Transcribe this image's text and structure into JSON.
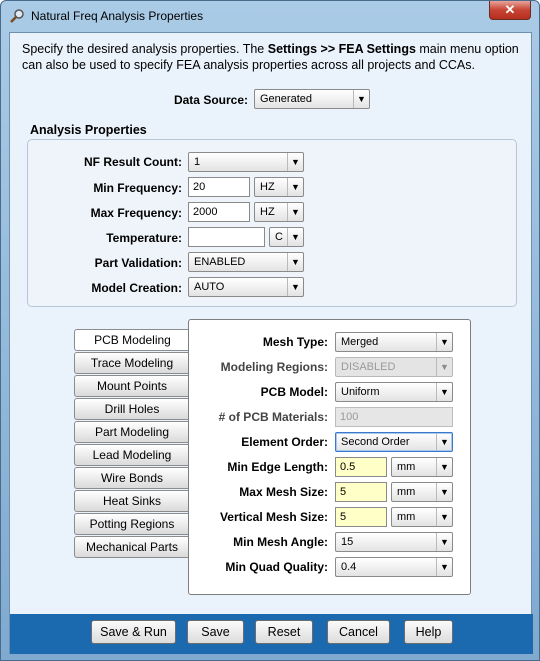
{
  "window": {
    "title": "Natural Freq Analysis Properties",
    "close_glyph": "✕"
  },
  "intro": {
    "part1": "Specify the desired analysis properties. The ",
    "bold": "Settings >> FEA Settings",
    "part2": " main menu option can also be used to specify FEA analysis properties across all projects and CCAs."
  },
  "data_source": {
    "label": "Data Source:",
    "value": "Generated"
  },
  "analysis_properties": {
    "title": "Analysis Properties",
    "nf_result_count": {
      "label": "NF Result Count:",
      "value": "1"
    },
    "min_frequency": {
      "label": "Min Frequency:",
      "value": "20",
      "unit": "HZ"
    },
    "max_frequency": {
      "label": "Max Frequency:",
      "value": "2000",
      "unit": "HZ"
    },
    "temperature": {
      "label": "Temperature:",
      "value": "",
      "unit": "C"
    },
    "part_validation": {
      "label": "Part Validation:",
      "value": "ENABLED"
    },
    "model_creation": {
      "label": "Model Creation:",
      "value": "AUTO"
    }
  },
  "tabs": [
    {
      "label": "PCB Modeling",
      "active": true
    },
    {
      "label": "Trace Modeling"
    },
    {
      "label": "Mount Points"
    },
    {
      "label": "Drill Holes"
    },
    {
      "label": "Part Modeling"
    },
    {
      "label": "Lead Modeling"
    },
    {
      "label": "Wire Bonds"
    },
    {
      "label": "Heat Sinks"
    },
    {
      "label": "Potting Regions"
    },
    {
      "label": "Mechanical Parts"
    }
  ],
  "pcb": {
    "mesh_type": {
      "label": "Mesh Type:",
      "value": "Merged"
    },
    "modeling_regions": {
      "label": "Modeling Regions:",
      "value": "DISABLED"
    },
    "pcb_model": {
      "label": "PCB Model:",
      "value": "Uniform"
    },
    "pcb_materials": {
      "label": "# of PCB Materials:",
      "value": "100"
    },
    "element_order": {
      "label": "Element Order:",
      "value": "Second Order"
    },
    "min_edge_length": {
      "label": "Min Edge Length:",
      "value": "0.5",
      "unit": "mm"
    },
    "max_mesh_size": {
      "label": "Max Mesh Size:",
      "value": "5",
      "unit": "mm"
    },
    "vertical_mesh_size": {
      "label": "Vertical Mesh Size:",
      "value": "5",
      "unit": "mm"
    },
    "min_mesh_angle": {
      "label": "Min Mesh Angle:",
      "value": "15"
    },
    "min_quad_quality": {
      "label": "Min Quad Quality:",
      "value": "0.4"
    }
  },
  "buttons": {
    "save_run": "Save & Run",
    "save": "Save",
    "reset": "Reset",
    "cancel": "Cancel",
    "help": "Help"
  },
  "icons": {
    "window": "magnifier-icon",
    "dropdown": "chevron-down-icon"
  },
  "colors": {
    "bottom_bar": "#1b6ab0",
    "highlight_field": "#ffffc8"
  }
}
